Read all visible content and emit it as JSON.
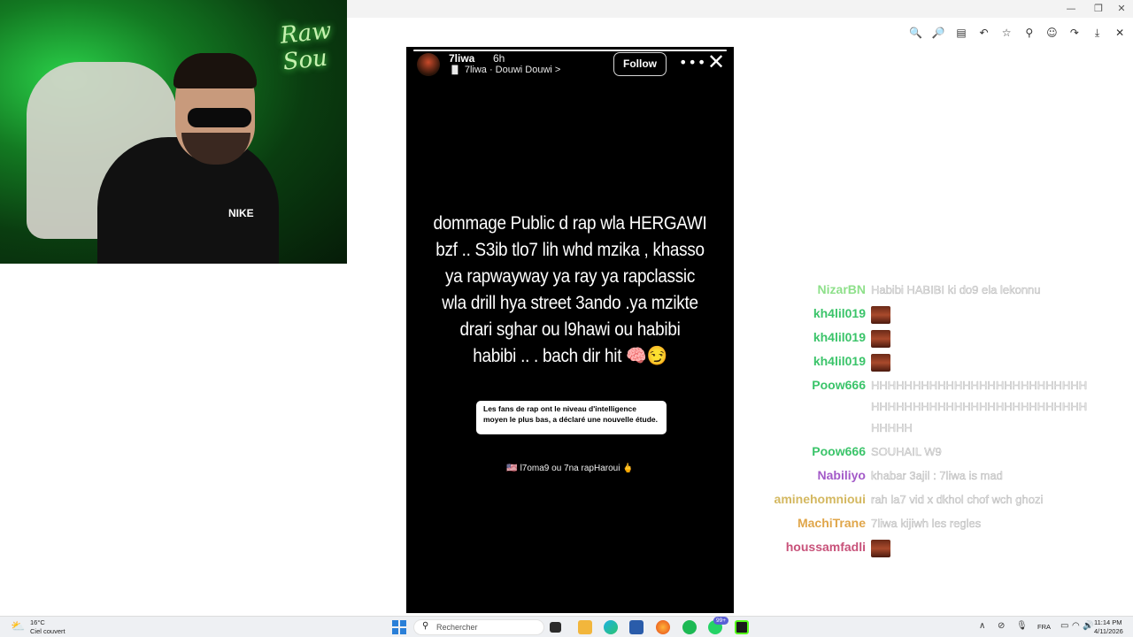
{
  "window": {
    "minimize_glyph": "—",
    "restore_glyph": "❐",
    "close_glyph": "✕"
  },
  "toolbar": {
    "icons": [
      "zoom-out-icon",
      "zoom-in-icon",
      "text-icon",
      "undo-icon",
      "star-icon",
      "pin-icon",
      "emoji-icon",
      "share-icon",
      "download-icon",
      "close-icon"
    ],
    "glyphs": [
      "🔍",
      "🔎",
      "▤",
      "↶",
      "☆",
      "⚲",
      "☺",
      "↷",
      "⤓",
      "✕"
    ]
  },
  "webcam": {
    "sign_text": "Raw Sou",
    "shirt_logo": "NIKE"
  },
  "story": {
    "username": "7liwa",
    "verified_glyph": "✓",
    "time": "6h",
    "music_icon": "▐▌",
    "music_text": "7liwa · Douwi Douwi >",
    "follow_label": "Follow",
    "more_glyph": "•••",
    "close_glyph": "✕",
    "progress": 1.0,
    "lines": [
      "dommage Public d rap wla HERGAWI",
      "bzf .. S3ib tlo7 lih whd mzika , khasso",
      "ya rapwayway ya ray ya rapclassic",
      "wla drill hya street 3ando .ya mzikte",
      "drari sghar ou l9hawi ou habibi",
      "habibi .. . bach dir hit 🧠😏"
    ],
    "quote": "Les fans de rap ont le niveau d'intelligence moyen le plus bas, a déclaré une nouvelle étude.",
    "caption": "🇺🇸 l7oma9 ou 7na rapHaroui 🖕"
  },
  "chat": {
    "messages": [
      {
        "user": "NizarBN",
        "color": "#8ee08a",
        "text": "Habibi HABIBI ki do9 ela lekonnu",
        "emote": false
      },
      {
        "user": "kh4lil019",
        "color": "#3bc46a",
        "text": "",
        "emote": true
      },
      {
        "user": "kh4lil019",
        "color": "#3bc46a",
        "text": "",
        "emote": true
      },
      {
        "user": "kh4lil019",
        "color": "#3bc46a",
        "text": "",
        "emote": true
      },
      {
        "user": "Poow666",
        "color": "#3bc46a",
        "text": "HHHHHHHHHHHHHHHHHHHHHHHHHHHHHHHHHHHHHHHHHHHHHHHHHHHHHHHHH",
        "emote": false
      },
      {
        "user": "Poow666",
        "color": "#3bc46a",
        "text": "SOUHAIL W9",
        "emote": false
      },
      {
        "user": "Nabiliyo",
        "color": "#a35ac8",
        "text": "khabar 3ajil : 7liwa is mad",
        "emote": false
      },
      {
        "user": "aminehomnioui",
        "color": "#d4b860",
        "text": "rah la7 vid x dkhol chof wch ghozi",
        "emote": false
      },
      {
        "user": "MachiTrane",
        "color": "#e0a64a",
        "text": "7liwa kijiwh les regles",
        "emote": false
      },
      {
        "user": "houssamfadli",
        "color": "#c8527a",
        "text": "",
        "emote": true
      }
    ]
  },
  "taskbar": {
    "weather_icon": "⛅",
    "temperature": "16°C",
    "weather": "Ciel couvert",
    "search_icon": "⚲",
    "search_placeholder": "Rechercher",
    "badge": "99+",
    "language": "FRA",
    "time": "11:14 PM",
    "date": "4/11/2026",
    "tray_icons": [
      "chevron-up-icon",
      "network-off-icon",
      "mic-icon",
      "display-icon",
      "wifi-icon",
      "volume-icon",
      "battery-icon"
    ],
    "tray_glyphs": [
      "∧",
      "⊘",
      "🎙",
      "▭",
      "◠",
      "🔊",
      "▮"
    ]
  }
}
